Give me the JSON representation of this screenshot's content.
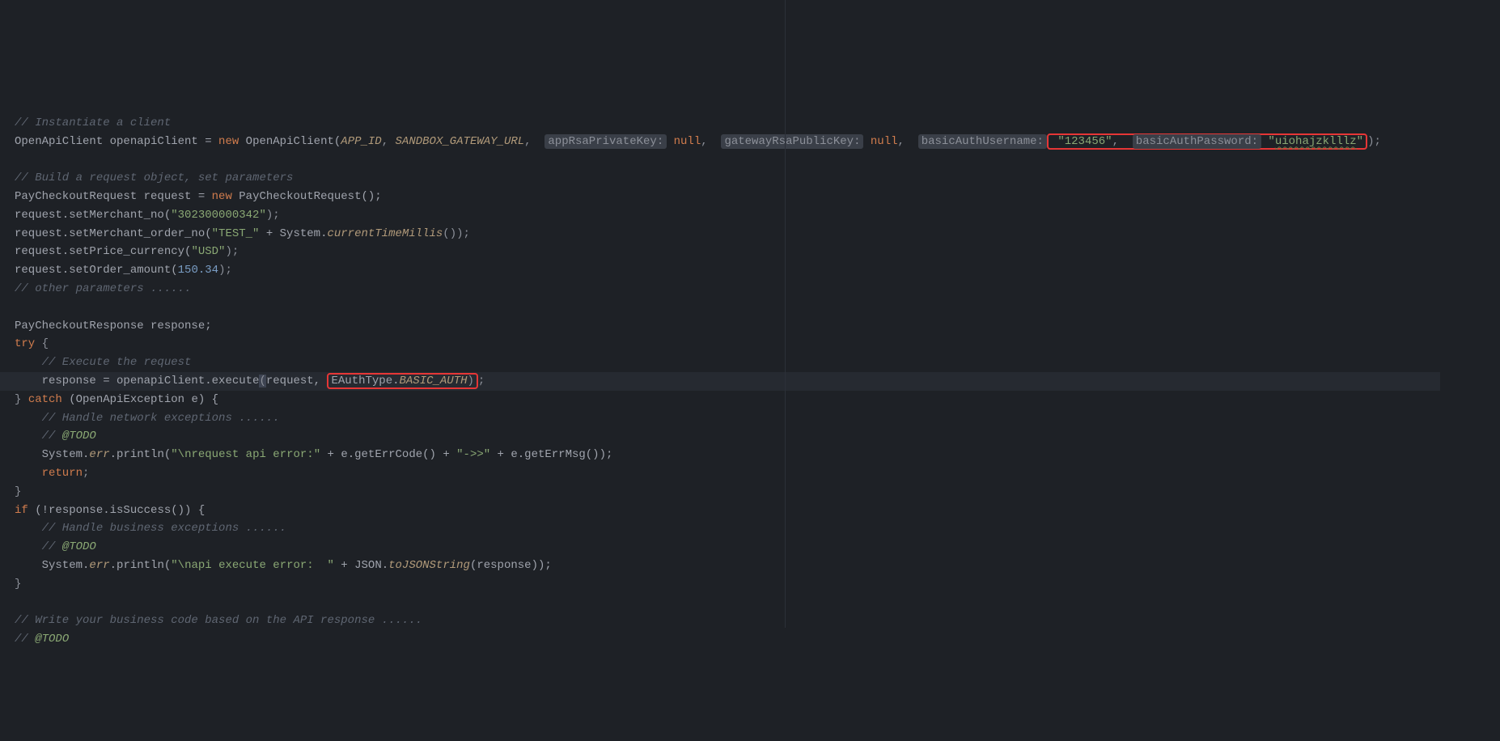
{
  "code": {
    "l1_comment": "// Instantiate a client",
    "l2_type1": "OpenApiClient",
    "l2_var": " openapiClient = ",
    "l2_new": "new",
    "l2_ctor": " OpenApiClient(",
    "l2_appid": "APP_ID",
    "l2_c1": ", ",
    "l2_gateway": "SANDBOX_GATEWAY_URL",
    "l2_c2": ", ",
    "l2_hint1": "appRsaPrivateKey:",
    "l2_null1": " null",
    "l2_c3": ", ",
    "l2_hint2": "gatewayRsaPublicKey:",
    "l2_null2": " null",
    "l2_c4": ", ",
    "l2_hint3": "basicAuthUsername:",
    "l2_user": " \"123456\"",
    "l2_c5": ", ",
    "l2_hint4": "basicAuthPassword:",
    "l2_pass": " \"",
    "l2_passv": "uiohajzklllz",
    "l2_passq": "\"",
    "l2_end": ");",
    "l4_comment": "// Build a request object, set parameters",
    "l5_a": "PayCheckoutRequest request = ",
    "l5_new": "new",
    "l5_b": " PayCheckoutRequest();",
    "l6_a": "request.setMerchant_no(",
    "l6_s": "\"302300000342\"",
    "l6_b": ");",
    "l7_a": "request.setMerchant_order_no(",
    "l7_s": "\"TEST_\"",
    "l7_b": " + System.",
    "l7_m": "currentTimeMillis",
    "l7_c": "());",
    "l8_a": "request.setPrice_currency(",
    "l8_s": "\"USD\"",
    "l8_b": ");",
    "l9_a": "request.setOrder_amount(",
    "l9_n": "150.34",
    "l9_b": ");",
    "l10_comment": "// other parameters ......",
    "l12": "PayCheckoutResponse response;",
    "l13_try": "try",
    "l13_b": " {",
    "l14_comment": "    // Execute the request",
    "l15_a": "    response = openapiClient.execute",
    "l15_p1": "(",
    "l15_b": "request, ",
    "l15_c": "EAuthType.",
    "l15_d": "BASIC_AUTH",
    "l15_p2": ")",
    "l15_e": ";",
    "l16_a": "} ",
    "l16_catch": "catch",
    "l16_b": " (OpenApiException e) {",
    "l17_comment": "    // Handle network exceptions ......",
    "l18_comment_a": "    // ",
    "l18_comment_b": "@TODO",
    "l19_a": "    System.",
    "l19_err": "err",
    "l19_b": ".println(",
    "l19_s1": "\"\\nrequest api error:\"",
    "l19_c": " + e.getErrCode() + ",
    "l19_s2": "\"->>\"",
    "l19_d": " + e.getErrMsg());",
    "l20_ret": "    return",
    "l20_b": ";",
    "l21": "}",
    "l22_if": "if",
    "l22_a": " (!response.isSuccess()) {",
    "l23_comment": "    // Handle business exceptions ......",
    "l24_comment_a": "    // ",
    "l24_comment_b": "@TODO",
    "l25_a": "    System.",
    "l25_err": "err",
    "l25_b": ".println(",
    "l25_s": "\"\\napi execute error:  \"",
    "l25_c": " + JSON.",
    "l25_m": "toJSONString",
    "l25_d": "(response));",
    "l26": "}",
    "l28_comment": "// Write your business code based on the API response ......",
    "l29_comment_a": "// ",
    "l29_comment_b": "@TODO"
  }
}
